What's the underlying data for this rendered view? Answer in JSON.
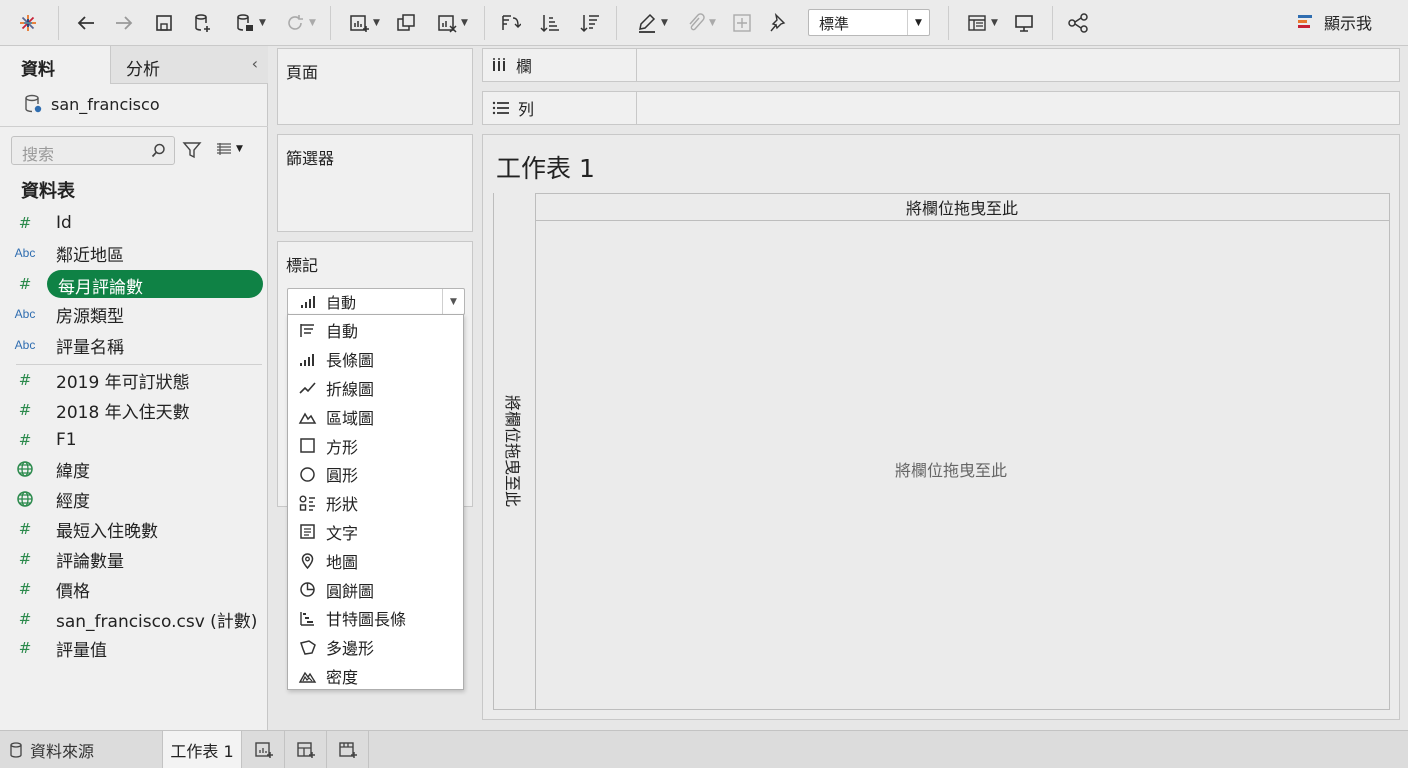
{
  "toolbar": {
    "fit_value": "標準",
    "show_me_label": "顯示我"
  },
  "data_pane": {
    "tab_data": "資料",
    "tab_analysis": "分析",
    "datasource_name": "san_francisco",
    "search_placeholder": "搜索",
    "tables_header": "資料表",
    "fields": [
      {
        "type": "measure",
        "type_icon": "#",
        "name": "Id"
      },
      {
        "type": "dimension",
        "type_icon": "Abc",
        "name": "鄰近地區"
      },
      {
        "type": "measure",
        "type_icon": "#",
        "name": "每月評論數",
        "selected": true
      },
      {
        "type": "dimension",
        "type_icon": "Abc",
        "name": "房源類型"
      },
      {
        "type": "dimension",
        "type_icon": "Abc",
        "name": "評量名稱"
      },
      {
        "type": "measure",
        "type_icon": "#",
        "name": "2019 年可訂狀態"
      },
      {
        "type": "measure",
        "type_icon": "#",
        "name": "2018 年入住天數"
      },
      {
        "type": "measure",
        "type_icon": "#",
        "name": "F1"
      },
      {
        "type": "geo",
        "type_icon": "globe-icon",
        "name": "緯度"
      },
      {
        "type": "geo",
        "type_icon": "globe-icon",
        "name": "經度"
      },
      {
        "type": "measure",
        "type_icon": "#",
        "name": "最短入住晚數"
      },
      {
        "type": "measure",
        "type_icon": "#",
        "name": "評論數量"
      },
      {
        "type": "measure",
        "type_icon": "#",
        "name": "價格"
      },
      {
        "type": "measure",
        "type_icon": "#",
        "name": "san_francisco.csv (計數)"
      },
      {
        "type": "measure",
        "type_icon": "#",
        "name": "評量值"
      }
    ]
  },
  "cards": {
    "pages": "頁面",
    "filters": "篩選器",
    "marks": "標記",
    "mark_type_value": "自動"
  },
  "mark_type_menu": [
    {
      "label": "自動",
      "icon": "auto-icon"
    },
    {
      "label": "長條圖",
      "icon": "bar-icon"
    },
    {
      "label": "折線圖",
      "icon": "line-icon"
    },
    {
      "label": "區域圖",
      "icon": "area-icon"
    },
    {
      "label": "方形",
      "icon": "square-icon"
    },
    {
      "label": "圓形",
      "icon": "circle-icon"
    },
    {
      "label": "形狀",
      "icon": "shape-icon"
    },
    {
      "label": "文字",
      "icon": "text-icon"
    },
    {
      "label": "地圖",
      "icon": "map-pin-icon"
    },
    {
      "label": "圓餅圖",
      "icon": "pie-icon"
    },
    {
      "label": "甘特圖長條",
      "icon": "gantt-icon"
    },
    {
      "label": "多邊形",
      "icon": "polygon-icon"
    },
    {
      "label": "密度",
      "icon": "density-icon"
    }
  ],
  "shelves": {
    "columns": "欄",
    "rows": "列"
  },
  "view": {
    "sheet_title": "工作表 1",
    "column_drop_text": "將欄位拖曳至此",
    "row_drop_text": "將欄位拖曳至此",
    "pane_drop_text": "將欄位拖曳至此"
  },
  "bottom_tabs": {
    "datasource": "資料來源",
    "sheet1": "工作表 1"
  },
  "colors": {
    "selected_field": "#0f8245",
    "measure_icon": "#2b8a4c",
    "dimension_icon": "#2f6db0"
  }
}
